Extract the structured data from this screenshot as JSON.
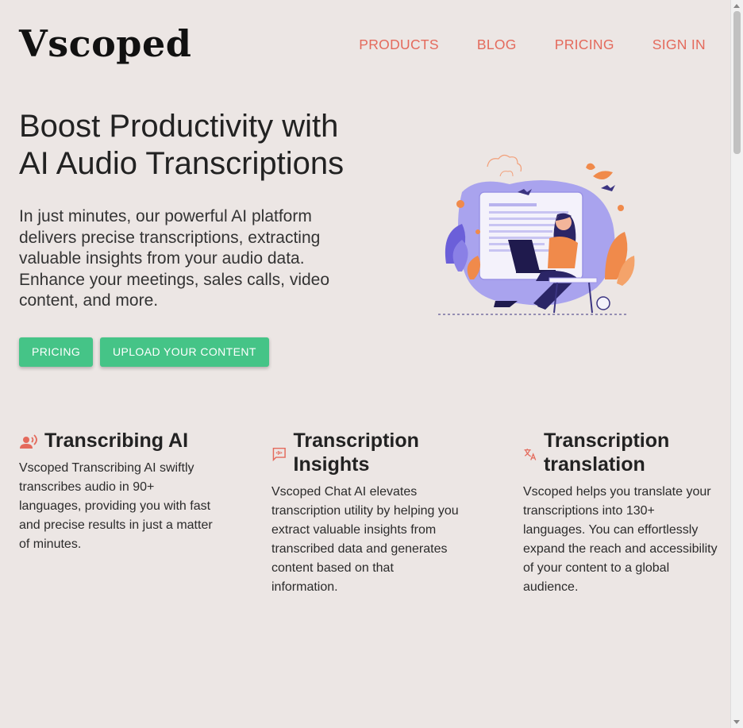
{
  "header": {
    "logo": "Vscoped",
    "nav": [
      "PRODUCTS",
      "BLOG",
      "PRICING",
      "SIGN IN"
    ]
  },
  "hero": {
    "title": "Boost Productivity with AI Audio Transcriptions",
    "subtitle": "In just minutes, our powerful AI platform delivers precise transcriptions, extracting valuable insights from your audio data. Enhance your meetings, sales calls, video content, and more.",
    "buttons": [
      "PRICING",
      "UPLOAD YOUR CONTENT"
    ]
  },
  "features": [
    {
      "icon": "voice-icon",
      "title": "Transcribing AI",
      "text": "Vscoped Transcribing AI swiftly transcribes audio in 90+ languages, providing you with fast and precise results in just a matter of minutes."
    },
    {
      "icon": "chat-waveform-icon",
      "title": "Transcription Insights",
      "text": "Vscoped Chat AI elevates transcription utility by helping you extract valuable insights from transcribed data and generates content based on that information."
    },
    {
      "icon": "translate-icon",
      "title": "Transcription translation",
      "text": "Vscoped helps you translate your transcriptions into 130+ languages. You can effortlessly expand the reach and accessibility of your content to a global audience."
    }
  ],
  "colors": {
    "accent": "#e46a5c",
    "button": "#45c487",
    "background": "#ece6e4"
  }
}
